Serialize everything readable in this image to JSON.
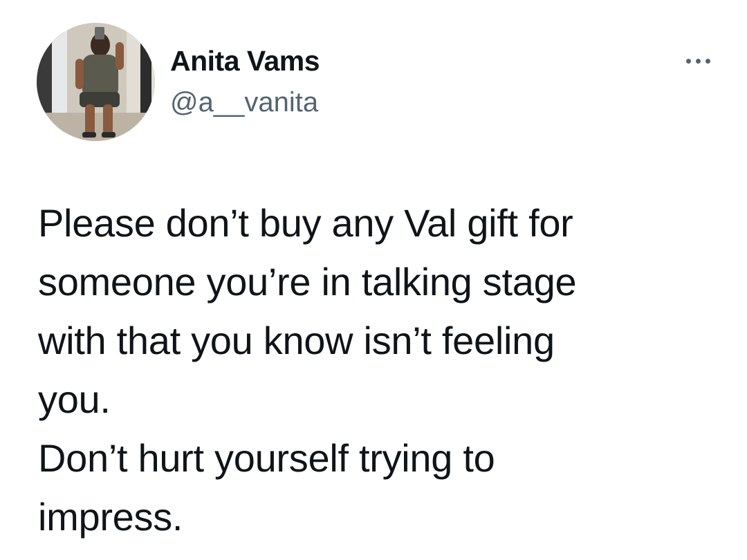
{
  "author": {
    "display_name": "Anita Vams",
    "handle": "@a__vanita",
    "avatar": "profile-photo"
  },
  "more_menu": {
    "icon": "more-horizontal-icon"
  },
  "tweet": {
    "lines": [
      "Please don’t buy any Val gift for",
      "someone you’re in talking stage",
      "with that you know isn’t feeling",
      "you.",
      "Don’t hurt yourself trying to",
      "impress."
    ]
  },
  "colors": {
    "text": "#0f1419",
    "secondary": "#536471",
    "background": "#ffffff"
  }
}
